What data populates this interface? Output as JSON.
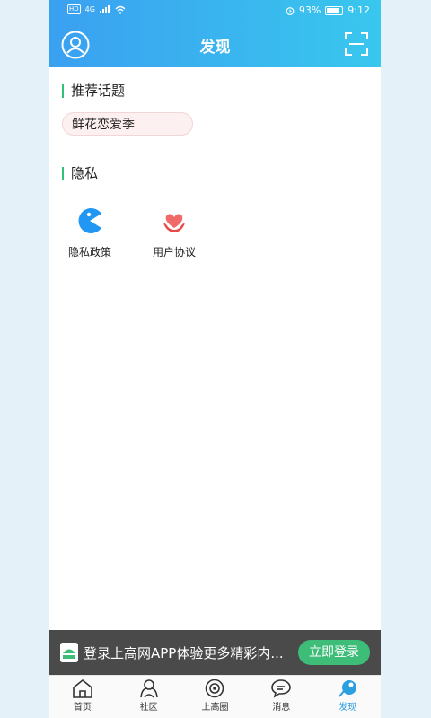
{
  "status_bar": {
    "network_badge": "HD",
    "signal_label": "4G",
    "battery_percent": "93%",
    "time": "9:12"
  },
  "header": {
    "title": "发现",
    "left_icon": "avatar-icon",
    "right_icon": "scan-icon"
  },
  "recommended": {
    "section_title": "推荐话题",
    "topics": [
      "鲜花恋爱季"
    ]
  },
  "privacy": {
    "section_title": "隐私",
    "items": [
      {
        "label": "隐私政策",
        "icon": "pacman-icon"
      },
      {
        "label": "用户协议",
        "icon": "heart-hands-icon"
      }
    ]
  },
  "login_banner": {
    "text": "登录上高网APP体验更多精彩内...",
    "button_label": "立即登录"
  },
  "tabbar": {
    "tabs": [
      {
        "label": "首页",
        "icon": "home-icon"
      },
      {
        "label": "社区",
        "icon": "community-icon"
      },
      {
        "label": "上高圈",
        "icon": "circle-icon"
      },
      {
        "label": "消息",
        "icon": "message-icon"
      },
      {
        "label": "发现",
        "icon": "discover-icon"
      }
    ],
    "active_index": 4
  },
  "colors": {
    "header_gradient_start": "#3aa0f0",
    "header_gradient_end": "#39c7ee",
    "accent_green": "#3dbd78",
    "tab_active": "#2b9fe0"
  }
}
